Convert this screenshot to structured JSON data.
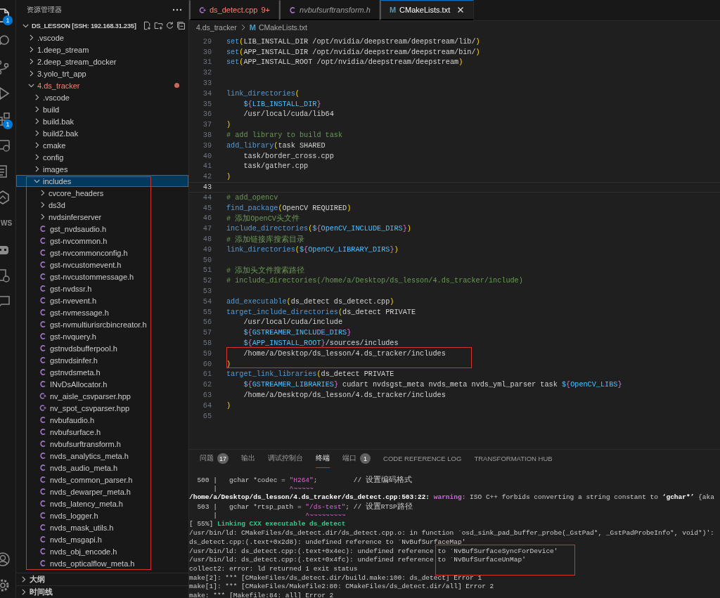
{
  "activity_bar": [
    {
      "kind": "files",
      "selected": true,
      "badge": "1"
    },
    {
      "kind": "search",
      "selected": false
    },
    {
      "kind": "source-control",
      "selected": false
    },
    {
      "kind": "run",
      "selected": false
    },
    {
      "kind": "extensions",
      "selected": false,
      "badge": "1"
    },
    {
      "kind": "remote",
      "selected": false
    },
    {
      "kind": "tests",
      "selected": false
    },
    {
      "kind": "hexagon",
      "selected": false
    },
    {
      "kind": "text",
      "selected": false,
      "label": "WS"
    },
    {
      "kind": "robot",
      "selected": false
    },
    {
      "kind": "gear-doc",
      "selected": false
    },
    {
      "kind": "chat",
      "selected": false
    }
  ],
  "activity_bar_bottom": [
    {
      "kind": "account"
    },
    {
      "kind": "settings"
    }
  ],
  "explorer": {
    "title": "资源管理器",
    "workspace": {
      "label": "DS_LESSON [SSH: 192.168.31.235]",
      "expanded": true
    },
    "tree": [
      {
        "label": ".vscode",
        "kind": "folder",
        "expanded": false,
        "has_errors": false,
        "selected": false
      },
      {
        "label": "1.deep_stream",
        "kind": "folder",
        "expanded": false,
        "has_errors": false,
        "selected": false
      },
      {
        "label": "2.deep_stream_docker",
        "kind": "folder",
        "expanded": false,
        "has_errors": false,
        "selected": false
      },
      {
        "label": "3.yolo_trt_app",
        "kind": "folder",
        "expanded": false,
        "has_errors": false,
        "selected": false
      },
      {
        "label": "4.ds_tracker",
        "kind": "folder",
        "expanded": true,
        "has_errors": true,
        "selected": false,
        "children": [
          {
            "label": ".vscode",
            "kind": "folder",
            "expanded": false,
            "has_errors": false,
            "selected": false
          },
          {
            "label": "build",
            "kind": "folder",
            "expanded": false,
            "has_errors": false,
            "selected": false
          },
          {
            "label": "build.bak",
            "kind": "folder",
            "expanded": false,
            "has_errors": false,
            "selected": false
          },
          {
            "label": "build2.bak",
            "kind": "folder",
            "expanded": false,
            "has_errors": false,
            "selected": false
          },
          {
            "label": "cmake",
            "kind": "folder",
            "expanded": false,
            "has_errors": false,
            "selected": false
          },
          {
            "label": "config",
            "kind": "folder",
            "expanded": false,
            "has_errors": false,
            "selected": false
          },
          {
            "label": "images",
            "kind": "folder",
            "expanded": false,
            "has_errors": false,
            "selected": false
          },
          {
            "label": "includes",
            "kind": "folder",
            "expanded": true,
            "has_errors": false,
            "selected": true,
            "children": [
              {
                "label": "cvcore_headers",
                "kind": "folder",
                "expanded": false,
                "has_errors": false,
                "selected": false
              },
              {
                "label": "ds3d",
                "kind": "folder",
                "expanded": false,
                "has_errors": false,
                "selected": false
              },
              {
                "label": "nvdsinferserver",
                "kind": "folder",
                "expanded": false,
                "has_errors": false,
                "selected": false
              },
              {
                "label": "gst_nvdsaudio.h",
                "kind": "c",
                "selected": false
              },
              {
                "label": "gst-nvcommon.h",
                "kind": "c",
                "selected": false
              },
              {
                "label": "gst-nvcommonconfig.h",
                "kind": "c",
                "selected": false
              },
              {
                "label": "gst-nvcustomevent.h",
                "kind": "c",
                "selected": false
              },
              {
                "label": "gst-nvcustommessage.h",
                "kind": "c",
                "selected": false
              },
              {
                "label": "gst-nvdssr.h",
                "kind": "c",
                "selected": false
              },
              {
                "label": "gst-nvevent.h",
                "kind": "c",
                "selected": false
              },
              {
                "label": "gst-nvmessage.h",
                "kind": "c",
                "selected": false
              },
              {
                "label": "gst-nvmultiurisrcbincreator.h",
                "kind": "c",
                "selected": false
              },
              {
                "label": "gst-nvquery.h",
                "kind": "c",
                "selected": false
              },
              {
                "label": "gstnvdsbufferpool.h",
                "kind": "c",
                "selected": false
              },
              {
                "label": "gstnvdsinfer.h",
                "kind": "c",
                "selected": false
              },
              {
                "label": "gstnvdsmeta.h",
                "kind": "c",
                "selected": false
              },
              {
                "label": "INvDsAllocator.h",
                "kind": "c",
                "selected": false
              },
              {
                "label": "nv_aisle_csvparser.hpp",
                "kind": "cpp",
                "selected": false
              },
              {
                "label": "nv_spot_csvparser.hpp",
                "kind": "cpp",
                "selected": false
              },
              {
                "label": "nvbufaudio.h",
                "kind": "c",
                "selected": false
              },
              {
                "label": "nvbufsurface.h",
                "kind": "c",
                "selected": false
              },
              {
                "label": "nvbufsurftransform.h",
                "kind": "c",
                "selected": false
              },
              {
                "label": "nvds_analytics_meta.h",
                "kind": "c",
                "selected": false
              },
              {
                "label": "nvds_audio_meta.h",
                "kind": "c",
                "selected": false
              },
              {
                "label": "nvds_common_parser.h",
                "kind": "c",
                "selected": false
              },
              {
                "label": "nvds_dewarper_meta.h",
                "kind": "c",
                "selected": false
              },
              {
                "label": "nvds_latency_meta.h",
                "kind": "c",
                "selected": false
              },
              {
                "label": "nvds_logger.h",
                "kind": "c",
                "selected": false
              },
              {
                "label": "nvds_mask_utils.h",
                "kind": "c",
                "selected": false
              },
              {
                "label": "nvds_msgapi.h",
                "kind": "c",
                "selected": false
              },
              {
                "label": "nvds_obj_encode.h",
                "kind": "c",
                "selected": false
              },
              {
                "label": "nvds_opticalflow_meta.h",
                "kind": "c",
                "selected": false
              }
            ]
          }
        ]
      }
    ],
    "sections": [
      {
        "label": "大纲",
        "expanded": false
      },
      {
        "label": "时间线",
        "expanded": false
      }
    ]
  },
  "editor": {
    "tabs": [
      {
        "label": "ds_detect.cpp",
        "kind": "cpp",
        "badge": "9+",
        "has_errors": true,
        "preview": false,
        "selected": false
      },
      {
        "label": "nvbufsurftransform.h",
        "kind": "c",
        "has_errors": false,
        "preview": true,
        "selected": false
      },
      {
        "label": "CMakeLists.txt",
        "kind": "text",
        "icon_letter": "M",
        "has_errors": false,
        "preview": false,
        "selected": true
      }
    ],
    "breadcrumb": [
      {
        "label": "4.ds_tracker"
      },
      {
        "label": "CMakeLists.txt",
        "icon_letter": "M"
      }
    ],
    "lines": [
      {
        "number": "29",
        "current": false,
        "segments": [
          {
            "kind": "cmd",
            "text": "set"
          },
          {
            "kind": "paren",
            "text": "("
          },
          {
            "kind": "plain",
            "text": "LIB_INSTALL_DIR /opt/nvidia/deepstream/deepstream/lib/"
          },
          {
            "kind": "paren",
            "text": ")"
          }
        ]
      },
      {
        "number": "30",
        "current": false,
        "segments": [
          {
            "kind": "cmd",
            "text": "set"
          },
          {
            "kind": "paren",
            "text": "("
          },
          {
            "kind": "plain",
            "text": "APP_INSTALL_DIR /opt/nvidia/deepstream/deepstream/bin/"
          },
          {
            "kind": "paren",
            "text": ")"
          }
        ]
      },
      {
        "number": "31",
        "current": false,
        "segments": [
          {
            "kind": "cmd",
            "text": "set"
          },
          {
            "kind": "paren",
            "text": "("
          },
          {
            "kind": "plain",
            "text": "APP_INSTALL_ROOT /opt/nvidia/deepstream/deepstream"
          },
          {
            "kind": "paren",
            "text": ")"
          }
        ]
      },
      {
        "number": "32",
        "current": false
      },
      {
        "number": "33",
        "current": false
      },
      {
        "number": "34",
        "current": false,
        "segments": [
          {
            "kind": "cmd",
            "text": "link_directories"
          },
          {
            "kind": "paren",
            "text": "("
          }
        ]
      },
      {
        "number": "35",
        "current": false,
        "indented": true,
        "segments": [
          {
            "kind": "var",
            "text": "$"
          },
          {
            "kind": "brace",
            "text": "{"
          },
          {
            "kind": "var",
            "text": "LIB_INSTALL_DIR"
          },
          {
            "kind": "brace",
            "text": "}"
          }
        ]
      },
      {
        "number": "36",
        "current": false,
        "indented": true,
        "segments": [
          {
            "kind": "plain",
            "text": "/usr/local/cuda/lib64"
          }
        ]
      },
      {
        "number": "37",
        "current": false,
        "segments": [
          {
            "kind": "paren",
            "text": ")"
          }
        ]
      },
      {
        "number": "38",
        "current": false,
        "segments": [
          {
            "kind": "comment",
            "text": "# add library to build task"
          }
        ]
      },
      {
        "number": "39",
        "current": false,
        "segments": [
          {
            "kind": "cmd",
            "text": "add_library"
          },
          {
            "kind": "paren",
            "text": "("
          },
          {
            "kind": "plain",
            "text": "task SHARED"
          }
        ]
      },
      {
        "number": "40",
        "current": false,
        "indented": true,
        "segments": [
          {
            "kind": "plain",
            "text": "task/border_cross.cpp"
          }
        ]
      },
      {
        "number": "41",
        "current": false,
        "indented": true,
        "segments": [
          {
            "kind": "plain",
            "text": "task/gather.cpp"
          }
        ]
      },
      {
        "number": "42",
        "current": false,
        "segments": [
          {
            "kind": "paren",
            "text": ")"
          }
        ]
      },
      {
        "number": "43",
        "current": true
      },
      {
        "number": "44",
        "current": false,
        "segments": [
          {
            "kind": "comment",
            "text": "# add_opencv"
          }
        ]
      },
      {
        "number": "45",
        "current": false,
        "segments": [
          {
            "kind": "cmd",
            "text": "find_package"
          },
          {
            "kind": "paren",
            "text": "("
          },
          {
            "kind": "plain",
            "text": "OpenCV REQUIRED"
          },
          {
            "kind": "paren",
            "text": ")"
          }
        ]
      },
      {
        "number": "46",
        "current": false,
        "segments": [
          {
            "kind": "comment",
            "text": "# 添加OpenCV头文件"
          }
        ]
      },
      {
        "number": "47",
        "current": false,
        "segments": [
          {
            "kind": "cmd",
            "text": "include_directories"
          },
          {
            "kind": "paren",
            "text": "("
          },
          {
            "kind": "var",
            "text": "$"
          },
          {
            "kind": "brace",
            "text": "{"
          },
          {
            "kind": "var",
            "text": "OpenCV_INCLUDE_DIRS"
          },
          {
            "kind": "brace",
            "text": "}"
          },
          {
            "kind": "paren",
            "text": ")"
          }
        ]
      },
      {
        "number": "48",
        "current": false,
        "segments": [
          {
            "kind": "comment",
            "text": "# 添加链接库搜索目录"
          }
        ]
      },
      {
        "number": "49",
        "current": false,
        "segments": [
          {
            "kind": "cmd",
            "text": "link_directories"
          },
          {
            "kind": "paren",
            "text": "("
          },
          {
            "kind": "var",
            "text": "$"
          },
          {
            "kind": "brace",
            "text": "{"
          },
          {
            "kind": "var",
            "text": "OpenCV_LIBRARY_DIRS"
          },
          {
            "kind": "brace",
            "text": "}"
          },
          {
            "kind": "paren",
            "text": ")"
          }
        ]
      },
      {
        "number": "50",
        "current": false
      },
      {
        "number": "51",
        "current": false,
        "segments": [
          {
            "kind": "comment",
            "text": "# 添加头文件搜索路径"
          }
        ]
      },
      {
        "number": "52",
        "current": false,
        "segments": [
          {
            "kind": "comment",
            "text": "# include_directories(/home/a/Desktop/ds_lesson/4.ds_tracker/include)"
          }
        ]
      },
      {
        "number": "53",
        "current": false
      },
      {
        "number": "54",
        "current": false,
        "segments": [
          {
            "kind": "cmd",
            "text": "add_executable"
          },
          {
            "kind": "paren",
            "text": "("
          },
          {
            "kind": "plain",
            "text": "ds_detect ds_detect.cpp"
          },
          {
            "kind": "paren",
            "text": ")"
          }
        ]
      },
      {
        "number": "55",
        "current": false,
        "segments": [
          {
            "kind": "cmd",
            "text": "target_include_directories"
          },
          {
            "kind": "paren",
            "text": "("
          },
          {
            "kind": "plain",
            "text": "ds_detect PRIVATE"
          }
        ]
      },
      {
        "number": "56",
        "current": false,
        "indented": true,
        "segments": [
          {
            "kind": "plain",
            "text": "/usr/local/cuda/include"
          }
        ]
      },
      {
        "number": "57",
        "current": false,
        "indented": true,
        "segments": [
          {
            "kind": "var",
            "text": "$"
          },
          {
            "kind": "brace",
            "text": "{"
          },
          {
            "kind": "var",
            "text": "GSTREAMER_INCLUDE_DIRS"
          },
          {
            "kind": "brace",
            "text": "}"
          }
        ]
      },
      {
        "number": "58",
        "current": false,
        "indented": true,
        "segments": [
          {
            "kind": "var",
            "text": "$"
          },
          {
            "kind": "brace",
            "text": "{"
          },
          {
            "kind": "var",
            "text": "APP_INSTALL_ROOT"
          },
          {
            "kind": "brace",
            "text": "}"
          },
          {
            "kind": "plain",
            "text": "/sources/includes"
          }
        ]
      },
      {
        "number": "59",
        "current": false,
        "indented": true,
        "segments": [
          {
            "kind": "plain",
            "text": "/home/a/Desktop/ds_lesson/4.ds_tracker/includes"
          }
        ]
      },
      {
        "number": "60",
        "current": false,
        "segments": [
          {
            "kind": "paren",
            "text": ")"
          }
        ]
      },
      {
        "number": "61",
        "current": false,
        "segments": [
          {
            "kind": "cmd",
            "text": "target_link_libraries"
          },
          {
            "kind": "paren",
            "text": "("
          },
          {
            "kind": "plain",
            "text": "ds_detect PRIVATE"
          }
        ]
      },
      {
        "number": "62",
        "current": false,
        "indented": true,
        "segments": [
          {
            "kind": "var",
            "text": "$"
          },
          {
            "kind": "brace",
            "text": "{"
          },
          {
            "kind": "var",
            "text": "GSTREAMER_LIBRARIES"
          },
          {
            "kind": "brace",
            "text": "}"
          },
          {
            "kind": "plain",
            "text": " cudart nvdsgst_meta nvds_meta nvds_yml_parser task "
          },
          {
            "kind": "var",
            "text": "$"
          },
          {
            "kind": "brace",
            "text": "{"
          },
          {
            "kind": "var",
            "text": "OpenCV_LIBS"
          },
          {
            "kind": "brace",
            "text": "}"
          }
        ]
      },
      {
        "number": "63",
        "current": false,
        "indented": true,
        "segments": [
          {
            "kind": "plain",
            "text": "/home/a/Desktop/ds_lesson/4.ds_tracker/includes"
          }
        ]
      },
      {
        "number": "64",
        "current": false,
        "segments": [
          {
            "kind": "paren",
            "text": ")"
          }
        ]
      },
      {
        "number": "65",
        "current": false
      }
    ]
  },
  "panel": {
    "tabs": [
      {
        "label": "问题",
        "badge": "17",
        "selected": false
      },
      {
        "label": "输出",
        "selected": false
      },
      {
        "label": "调试控制台",
        "selected": false
      },
      {
        "label": "终端",
        "selected": true
      },
      {
        "label": "端口",
        "badge": "1",
        "selected": false
      },
      {
        "label": "CODE REFERENCE LOG",
        "selected": false
      },
      {
        "label": "TRANSFORMATION HUB",
        "selected": false
      }
    ],
    "terminal": [
      [
        {
          "kind": "plain",
          "text": "  500 |   gchar *codec = "
        },
        {
          "kind": "str",
          "text": "\"H264\""
        },
        {
          "kind": "plain",
          "text": ";         // 设置编码格式"
        }
      ],
      [
        {
          "kind": "plain",
          "text": "      |                  "
        },
        {
          "kind": "str",
          "text": "^~~~~~"
        }
      ],
      [
        {
          "kind": "bold",
          "text": "/home/a/Desktop/ds_lesson/4.ds_tracker/ds_detect.cpp:503:22: "
        },
        {
          "kind": "warn",
          "text": "warning:"
        },
        {
          "kind": "plain",
          "text": " ISO C++ forbids converting a string constant to "
        },
        {
          "kind": "bold",
          "text": "‘gchar*’"
        },
        {
          "kind": "plain",
          "text": " {aka"
        }
      ],
      [
        {
          "kind": "plain",
          "text": "  503 |   gchar *rtsp_path = "
        },
        {
          "kind": "str",
          "text": "\"/ds-test\""
        },
        {
          "kind": "plain",
          "text": "; // 设置RTSP路径"
        }
      ],
      [
        {
          "kind": "plain",
          "text": "      |                      "
        },
        {
          "kind": "str",
          "text": "^~~~~~~~~~"
        }
      ],
      [
        {
          "kind": "plain",
          "text": "[ 55%] "
        },
        {
          "kind": "ok",
          "text": "Linking CXX executable ds_detect"
        }
      ],
      [
        {
          "kind": "plain",
          "text": "/usr/bin/ld: CMakeFiles/ds_detect.dir/ds_detect.cpp.o: in function `osd_sink_pad_buffer_probe(_GstPad*, _GstPadProbeInfo*, void*)':"
        }
      ],
      [
        {
          "kind": "plain",
          "text": "ds_detect.cpp:(.text+0x2d8): undefined reference to `NvBufSurfaceMap'"
        }
      ],
      [
        {
          "kind": "plain",
          "text": "/usr/bin/ld: ds_detect.cpp:(.text+0x4ec): undefined reference to `NvBufSurfaceSyncForDevice'"
        }
      ],
      [
        {
          "kind": "plain",
          "text": "/usr/bin/ld: ds_detect.cpp:(.text+0x4fc): undefined reference to `NvBufSurfaceUnMap'"
        }
      ],
      [
        {
          "kind": "plain",
          "text": "collect2: error: ld returned 1 exit status"
        }
      ],
      [
        {
          "kind": "plain",
          "text": "make[2]: *** [CMakeFiles/ds_detect.dir/build.make:100: ds_detect] Error 1"
        }
      ],
      [
        {
          "kind": "plain",
          "text": "make[1]: *** [CMakeFiles/Makefile2:80: CMakeFiles/ds_detect.dir/all] Error 2"
        }
      ],
      [
        {
          "kind": "plain",
          "text": "make: *** [Makefile:84: all] Error 2"
        }
      ]
    ]
  },
  "annotations": [
    {
      "kind": "explorer"
    },
    {
      "kind": "editor"
    },
    {
      "kind": "terminal"
    }
  ]
}
